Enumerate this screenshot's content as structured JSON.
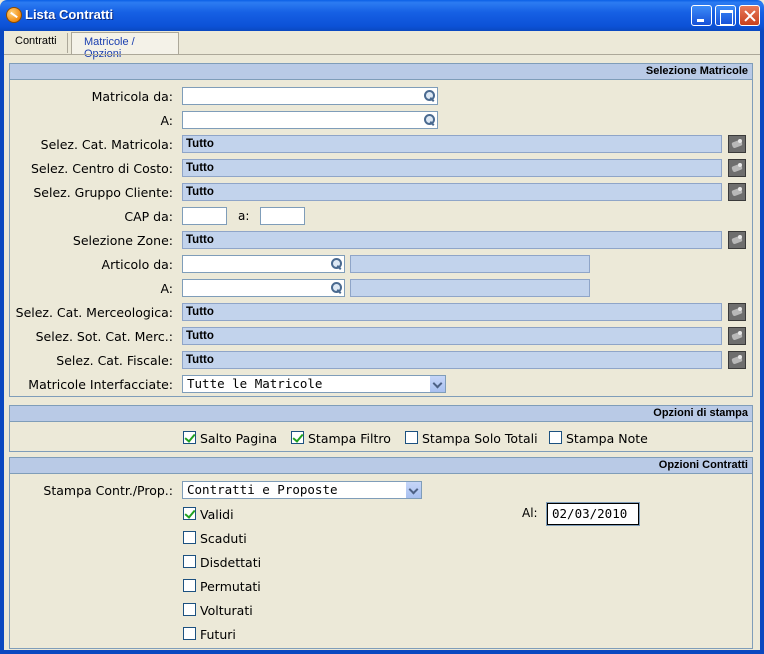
{
  "window": {
    "title": "Lista Contratti"
  },
  "tabs": [
    {
      "label": "Contratti"
    },
    {
      "label": "Matricole / Opzioni"
    }
  ],
  "selezione_matricole": {
    "header": "Selezione Matricole",
    "matricola_da_label": "Matricola da:",
    "matricola_a_label": "A:",
    "matricola_da_value": "",
    "matricola_a_value": "",
    "cat_matricola_label": "Selez. Cat. Matricola:",
    "cat_matricola_value": "Tutto",
    "centro_costo_label": "Selez. Centro di Costo:",
    "centro_costo_value": "Tutto",
    "gruppo_cliente_label": "Selez. Gruppo Cliente:",
    "gruppo_cliente_value": "Tutto",
    "cap_da_label": "CAP da:",
    "cap_a_label": "a:",
    "cap_da_value": "",
    "cap_a_value": "",
    "zone_label": "Selezione Zone:",
    "zone_value": "Tutto",
    "articolo_da_label": "Articolo da:",
    "articolo_a_label": "A:",
    "articolo_da_value": "",
    "articolo_a_value": "",
    "articolo_da_desc": "",
    "articolo_a_desc": "",
    "cat_merceologica_label": "Selez. Cat. Merceologica:",
    "cat_merceologica_value": "Tutto",
    "sot_cat_merc_label": "Selez. Sot. Cat. Merc.:",
    "sot_cat_merc_value": "Tutto",
    "cat_fiscale_label": "Selez. Cat. Fiscale:",
    "cat_fiscale_value": "Tutto",
    "matricole_interfacciate_label": "Matricole Interfacciate:",
    "matricole_interfacciate_value": "Tutte le Matricole"
  },
  "opzioni_stampa": {
    "header": "Opzioni di stampa",
    "checkboxes": [
      {
        "label": "Salto Pagina",
        "checked": true
      },
      {
        "label": "Stampa Filtro",
        "checked": true
      },
      {
        "label": "Stampa Solo Totali",
        "checked": false
      },
      {
        "label": "Stampa Note",
        "checked": false
      }
    ]
  },
  "opzioni_contratti": {
    "header": "Opzioni Contratti",
    "stampa_label": "Stampa Contr./Prop.:",
    "stampa_value": "Contratti e Proposte",
    "al_label": "Al:",
    "al_value": "02/03/2010",
    "checkboxes": [
      {
        "label": "Validi",
        "checked": true
      },
      {
        "label": "Scaduti",
        "checked": false
      },
      {
        "label": "Disdettati",
        "checked": false
      },
      {
        "label": "Permutati",
        "checked": false
      },
      {
        "label": "Volturati",
        "checked": false
      },
      {
        "label": "Futuri",
        "checked": false
      }
    ]
  }
}
